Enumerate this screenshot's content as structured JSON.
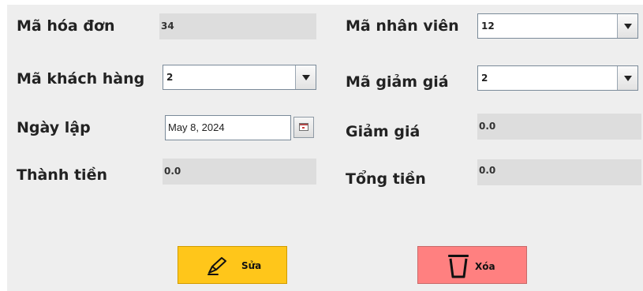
{
  "form": {
    "invoice_id": {
      "label": "Mã hóa đơn",
      "value": "34"
    },
    "employee_id": {
      "label": "Mã nhân viên",
      "value": "12"
    },
    "customer_id": {
      "label": "Mã khách hàng",
      "value": "2"
    },
    "discount_id": {
      "label": "Mã giảm giá",
      "value": "2"
    },
    "created_date": {
      "label": "Ngày lập",
      "value": "May 8, 2024"
    },
    "discount": {
      "label": "Giảm giá",
      "value": "0.0"
    },
    "subtotal": {
      "label": "Thành tiền",
      "value": "0.0"
    },
    "total": {
      "label": "Tổng tiền",
      "value": "0.0"
    }
  },
  "actions": {
    "edit_label": "Sửa",
    "delete_label": "Xóa"
  },
  "colors": {
    "panel_bg": "#eeeeee",
    "readonly_bg": "#dddddd",
    "edit_button": "#ffc61a",
    "delete_button": "#ff8080"
  },
  "icons": {
    "edit": "pencil-icon",
    "delete": "trash-icon",
    "calendar": "calendar-icon",
    "dropdown": "chevron-down-icon"
  }
}
